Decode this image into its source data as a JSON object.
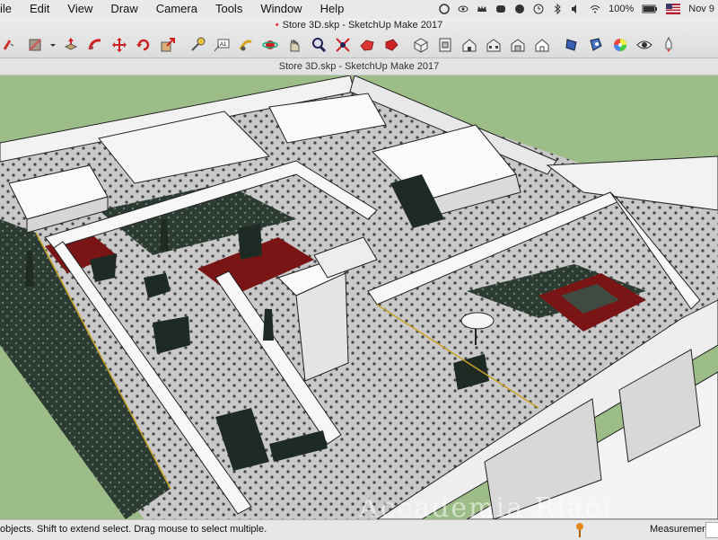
{
  "menubar": {
    "items": [
      "ile",
      "Edit",
      "View",
      "Draw",
      "Camera",
      "Tools",
      "Window",
      "Help"
    ],
    "battery": "100%",
    "clock": "Nov 9"
  },
  "window": {
    "doc_title": "Store 3D.skp - SketchUp Make 2017",
    "subtitle": "Store 3D.skp - SketchUp Make 2017"
  },
  "toolbar": {
    "icons": [
      "eraser-icon",
      "paint-bucket-icon",
      "push-pull-icon",
      "follow-me-icon",
      "move-icon",
      "rotate-icon",
      "scale-icon",
      "tape-measure-icon",
      "text-icon",
      "dimension-icon",
      "orbit-icon",
      "pan-icon",
      "zoom-icon",
      "zoom-extents-icon",
      "previous-view-icon",
      "next-view-icon",
      "iso-view-icon",
      "top-view-icon",
      "front-view-icon",
      "right-view-icon",
      "back-view-icon",
      "left-view-icon",
      "shadows-icon",
      "fog-icon",
      "color-wheel-icon",
      "eye-icon",
      "rocket-icon"
    ]
  },
  "watermark": "Accademia Riaci",
  "statusbar": {
    "hint": "objects. Shift to extend select. Drag mouse to select multiple.",
    "measurements_label": "Measurements"
  },
  "colors": {
    "ground": "#9dbd88",
    "floor": "#c9c9c9",
    "wall": "#f2f2f2",
    "rug": "#7a1515",
    "dark": "#1d2b24"
  }
}
